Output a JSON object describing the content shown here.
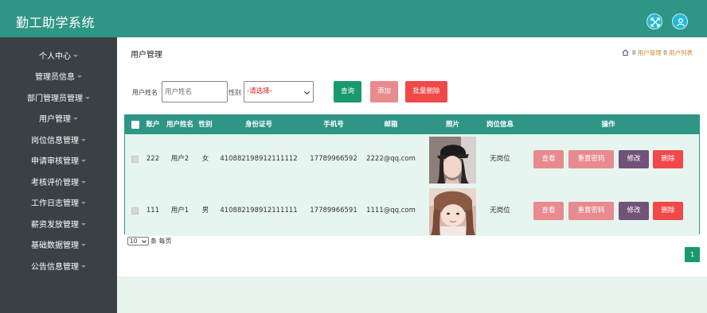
{
  "app": {
    "title": "勤工助学系统"
  },
  "header": {
    "icons": [
      "expand-icon",
      "user-icon"
    ]
  },
  "sidebar": {
    "items": [
      {
        "label": "个人中心"
      },
      {
        "label": "管理员信息"
      },
      {
        "label": "部门管理员管理"
      },
      {
        "label": "用户管理"
      },
      {
        "label": "岗位信息管理"
      },
      {
        "label": "申请审核管理"
      },
      {
        "label": "考核评价管理"
      },
      {
        "label": "工作日志管理"
      },
      {
        "label": "薪资发放管理"
      },
      {
        "label": "基础数据管理"
      },
      {
        "label": "公告信息管理"
      }
    ]
  },
  "page": {
    "title": "用户管理",
    "breadcrumb": {
      "sep": "II",
      "section": "用户管理",
      "current": "用户列表"
    }
  },
  "filters": {
    "name_label": "用户姓名",
    "name_placeholder": "用户姓名",
    "gender_label": "性别",
    "gender_selected": "-请选择-",
    "search_label": "查询",
    "add_label": "添加",
    "bulk_delete_label": "批量删除"
  },
  "table": {
    "headers": {
      "account": "账户",
      "name": "用户姓名",
      "gender": "性别",
      "idcard": "身份证号",
      "phone": "手机号",
      "email": "邮箱",
      "photo": "照片",
      "post": "岗位信息",
      "ops": "操作"
    },
    "rows": [
      {
        "account": "222",
        "name": "用户2",
        "gender": "女",
        "idcard": "410882198912111112",
        "phone": "17789966592",
        "email": "2222@qq.com",
        "post": "无岗位"
      },
      {
        "account": "111",
        "name": "用户1",
        "gender": "男",
        "idcard": "410882198912111111",
        "phone": "17789966591",
        "email": "1111@qq.com",
        "post": "无岗位"
      }
    ],
    "actions": {
      "view": "查看",
      "reset": "重置密码",
      "edit": "修改",
      "delete": "删除"
    }
  },
  "pagination": {
    "page_size": "10",
    "page_size_suffix": "条 每页",
    "current_page": "1"
  }
}
